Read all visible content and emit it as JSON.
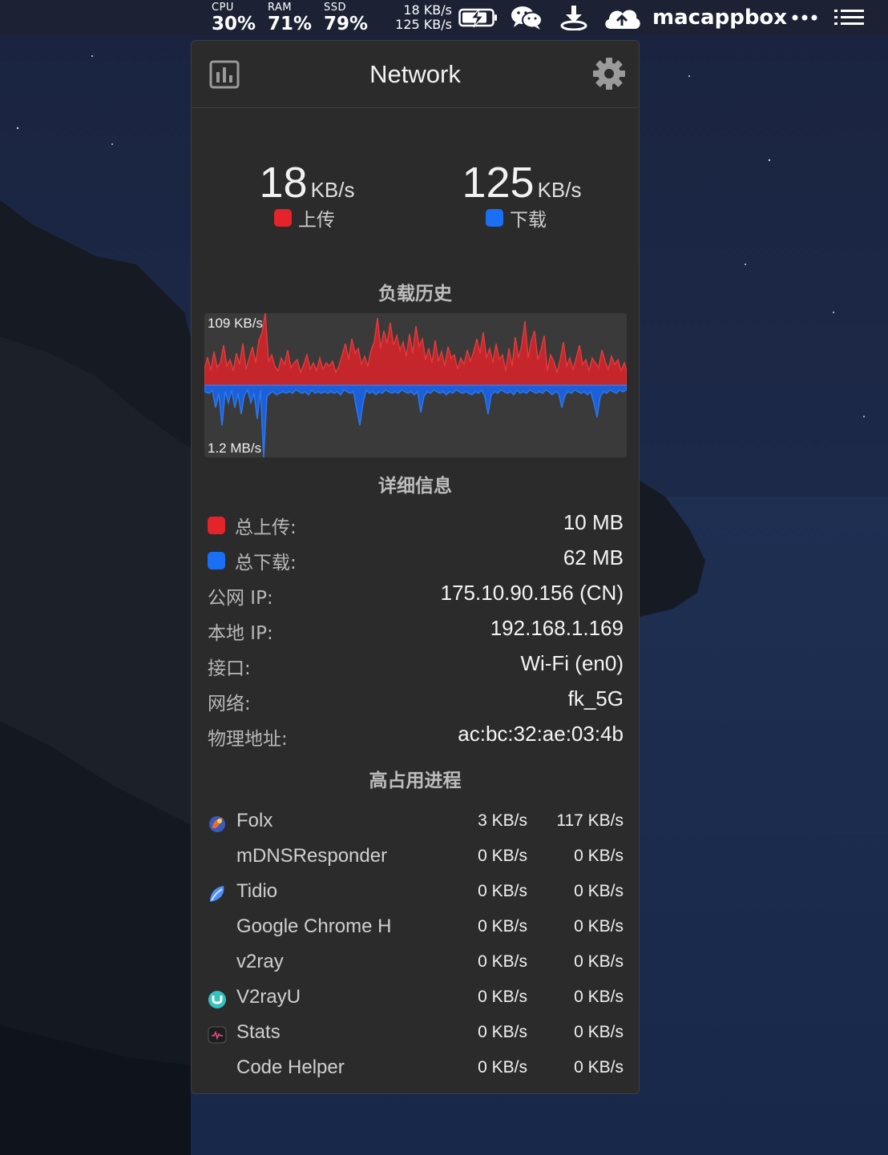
{
  "menubar": {
    "cpu": {
      "label": "CPU",
      "value": "30%"
    },
    "ram": {
      "label": "RAM",
      "value": "71%"
    },
    "ssd": {
      "label": "SSD",
      "value": "79%"
    },
    "speed_up": "18 KB/s",
    "speed_down": "125 KB/s",
    "icons": [
      "battery-charging-icon",
      "wechat-icon",
      "download-icon",
      "cloud-icon",
      "more-icon",
      "list-icon"
    ],
    "username": "macappbox"
  },
  "panel": {
    "title": "Network",
    "upload": {
      "value": "18",
      "unit": "KB/s",
      "label": "上传",
      "color": "#e5232b"
    },
    "download": {
      "value": "125",
      "unit": "KB/s",
      "label": "下载",
      "color": "#1a6ff5"
    },
    "history": {
      "title": "负载历史",
      "max_up_label": "109 KB/s",
      "max_down_label": "1.2 MB/s",
      "up_color": "#c4262b",
      "down_color": "#1c5fd9"
    },
    "details": {
      "title": "详细信息",
      "rows": [
        {
          "label": "总上传:",
          "value": "10 MB"
        },
        {
          "label": "总下载:",
          "value": "62 MB"
        },
        {
          "label": "公网 IP:",
          "value": "175.10.90.156 (CN)"
        },
        {
          "label": "本地 IP:",
          "value": "192.168.1.169"
        },
        {
          "label": "接口:",
          "value": "Wi-Fi (en0)"
        },
        {
          "label": "网络:",
          "value": "fk_5G"
        },
        {
          "label": "物理地址:",
          "value": "ac:bc:32:ae:03:4b"
        }
      ]
    },
    "processes": {
      "title": "高占用进程",
      "rows": [
        {
          "name": "Folx",
          "up": "3 KB/s",
          "down": "117 KB/s",
          "icon": "folx-icon"
        },
        {
          "name": "mDNSResponder",
          "up": "0 KB/s",
          "down": "0 KB/s",
          "icon": ""
        },
        {
          "name": "Tidio",
          "up": "0 KB/s",
          "down": "0 KB/s",
          "icon": "tidio-icon"
        },
        {
          "name": "Google Chrome H",
          "up": "0 KB/s",
          "down": "0 KB/s",
          "icon": ""
        },
        {
          "name": "v2ray",
          "up": "0 KB/s",
          "down": "0 KB/s",
          "icon": ""
        },
        {
          "name": "V2rayU",
          "up": "0 KB/s",
          "down": "0 KB/s",
          "icon": "v2rayu-icon"
        },
        {
          "name": "Stats",
          "up": "0 KB/s",
          "down": "0 KB/s",
          "icon": "stats-icon"
        },
        {
          "name": "Code Helper",
          "up": "0 KB/s",
          "down": "0 KB/s",
          "icon": ""
        }
      ]
    }
  }
}
